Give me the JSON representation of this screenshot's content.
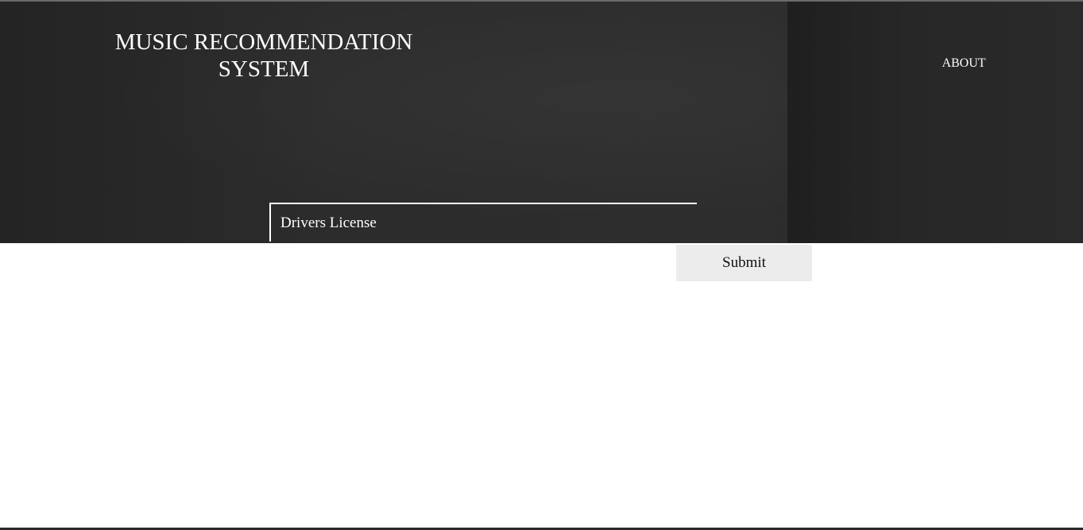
{
  "header": {
    "title": "MUSIC RECOMMENDATION SYSTEM",
    "nav_about": "ABOUT"
  },
  "search": {
    "value": "Drivers License",
    "placeholder": ""
  },
  "form": {
    "submit_label": "Submit"
  },
  "colors": {
    "hero_background": "#2a2a2a",
    "text_light": "#ffffff",
    "button_background": "#ececec",
    "page_background": "#ffffff"
  }
}
